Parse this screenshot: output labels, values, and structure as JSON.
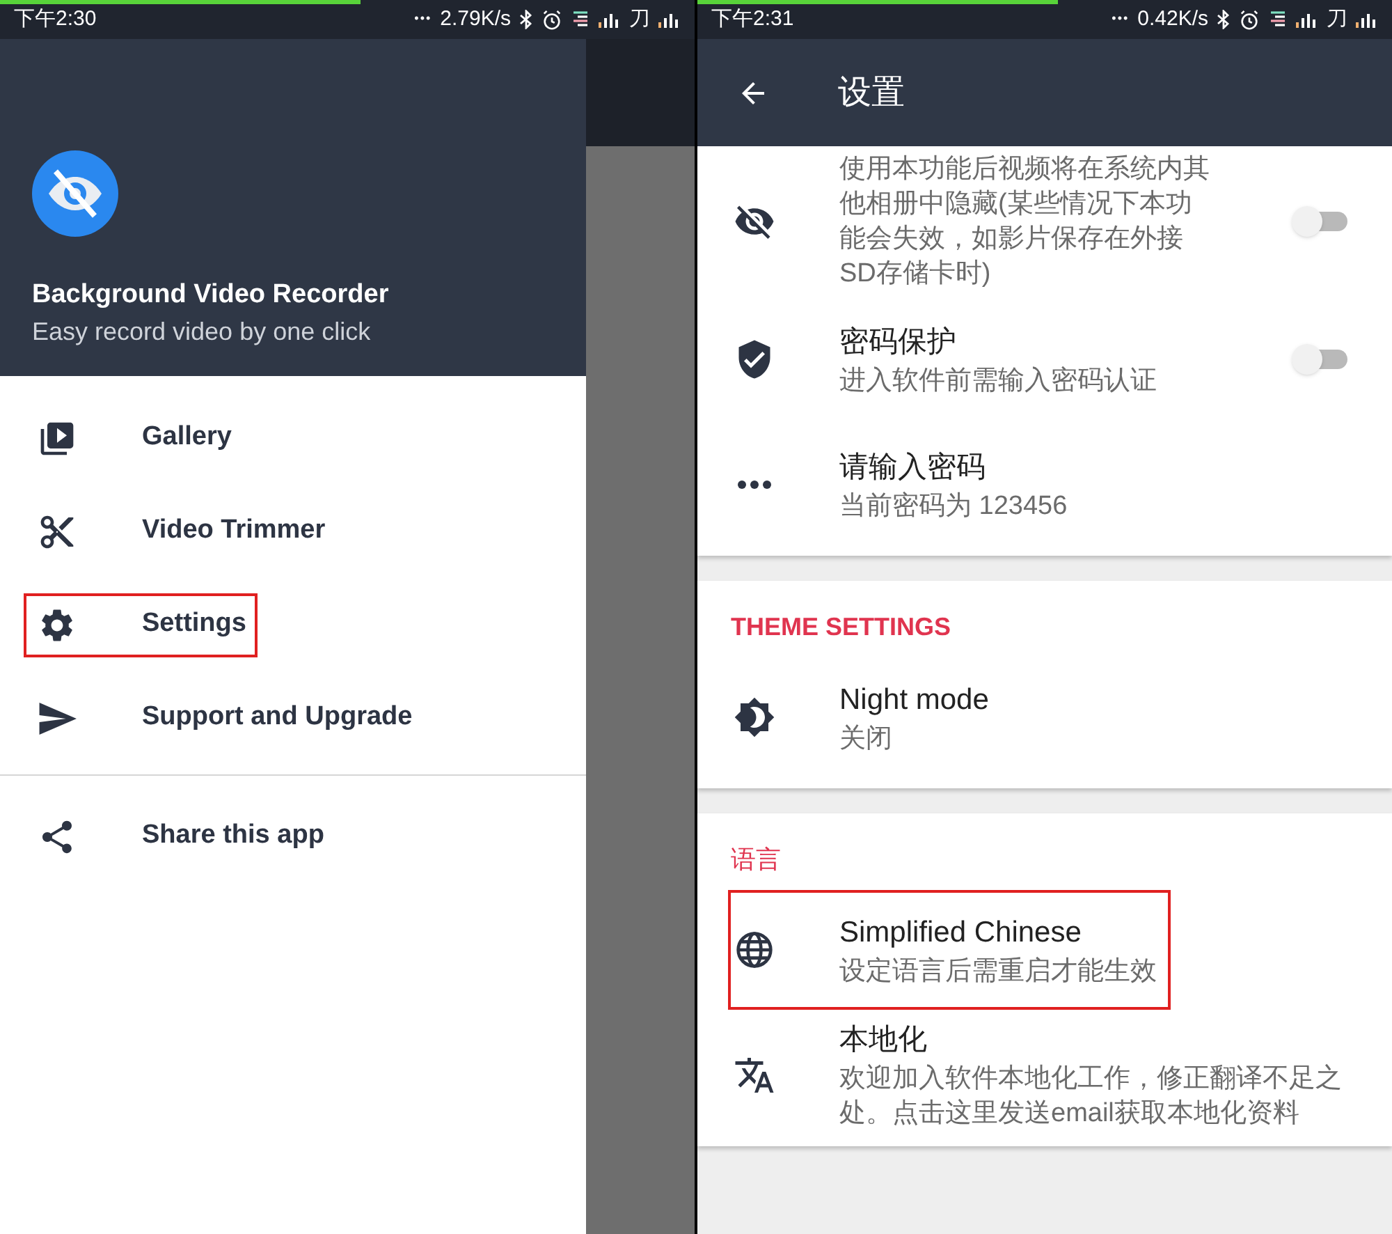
{
  "status_bars": [
    {
      "time": "下午2:30",
      "dots": "•••",
      "speed": "2.79K/s",
      "carrier": "刀",
      "level": 0.52
    },
    {
      "time": "下午2:31",
      "dots": "•••",
      "speed": "0.42K/s",
      "carrier": "刀",
      "level": 0.52
    }
  ],
  "drawer": {
    "app_title": "Background Video Recorder",
    "app_subtitle": "Easy record video by one click",
    "items": [
      {
        "kind": "gallery",
        "label": "Gallery",
        "highlighted": false
      },
      {
        "kind": "scissors",
        "label": "Video Trimmer",
        "highlighted": false
      },
      {
        "kind": "gear",
        "label": "Settings",
        "highlighted": true
      },
      {
        "kind": "send",
        "label": "Support and Upgrade",
        "highlighted": false
      }
    ],
    "secondary_items": [
      {
        "kind": "share",
        "label": "Share this app",
        "highlighted": false
      }
    ]
  },
  "settings": {
    "title": "设置",
    "sections": [
      {
        "items": [
          {
            "kind": "eye-off",
            "subtitle": "使用本功能后视频将在系统内其他相册中隐藏(某些情况下本功能会失效，如影片保存在外接SD存储卡时)",
            "toggle": {
              "on": false
            },
            "highlighted": false
          },
          {
            "kind": "shield",
            "title": "密码保护",
            "subtitle": "进入软件前需输入密码认证",
            "toggle": {
              "on": false
            },
            "highlighted": false
          },
          {
            "kind": "dots",
            "title": "请输入密码",
            "subtitle": "当前密码为 123456",
            "highlighted": false
          }
        ]
      },
      {
        "header": "THEME SETTINGS",
        "items": [
          {
            "kind": "brightness",
            "title": "Night mode",
            "subtitle": "关闭",
            "highlighted": false
          }
        ]
      },
      {
        "header": "语言",
        "items": [
          {
            "kind": "globe",
            "title": "Simplified Chinese",
            "subtitle": "设定语言后需重启才能生效",
            "highlighted": true
          },
          {
            "kind": "translate",
            "title": "本地化",
            "subtitle": "欢迎加入软件本地化工作，修正翻译不足之处。点击这里发送email获取本地化资料",
            "highlighted": false
          }
        ]
      }
    ]
  }
}
